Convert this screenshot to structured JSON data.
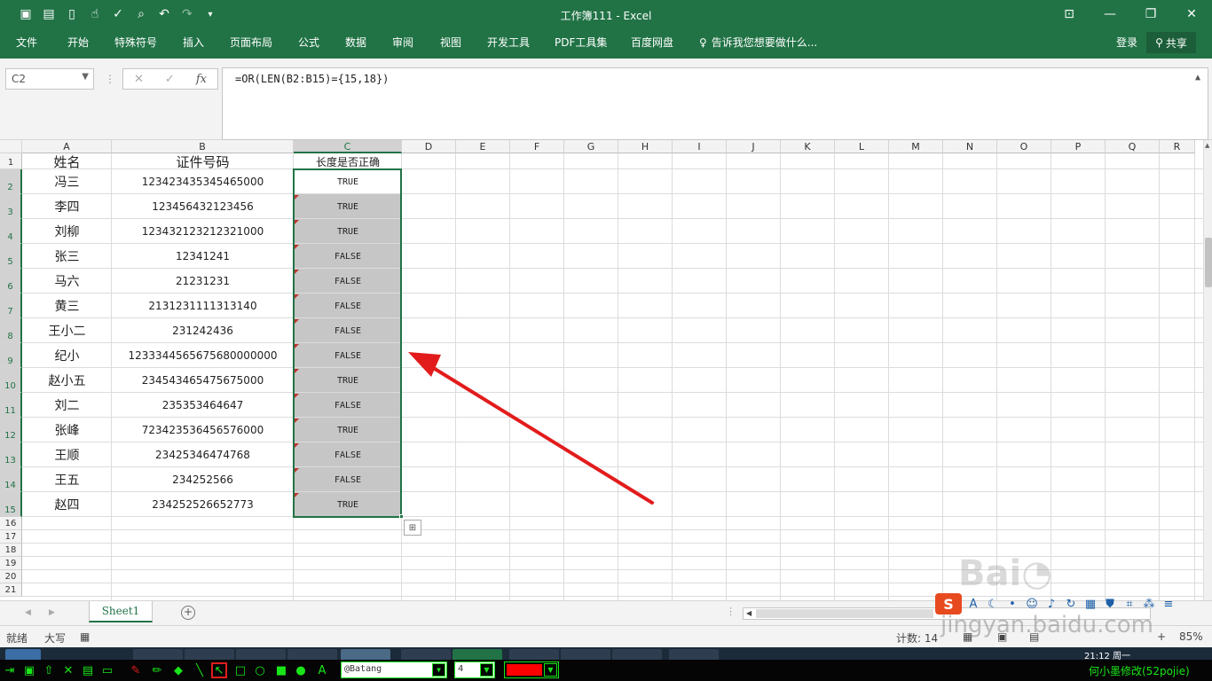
{
  "window": {
    "title": "工作簿111 - Excel"
  },
  "ribbon": {
    "tabs": [
      "文件",
      "开始",
      "特殊符号",
      "插入",
      "页面布局",
      "公式",
      "数据",
      "审阅",
      "视图",
      "开发工具",
      "PDF工具集",
      "百度网盘"
    ],
    "tell_me": "告诉我您想要做什么...",
    "login": "登录",
    "share": "共享"
  },
  "formula_bar": {
    "name_box": "C2",
    "formula": "=OR(LEN(B2:B15)={15,18})",
    "fx_label": "fx"
  },
  "grid": {
    "columns": [
      "A",
      "B",
      "C",
      "D",
      "E",
      "F",
      "G",
      "H",
      "I",
      "J",
      "K",
      "L",
      "M",
      "N",
      "O",
      "P",
      "Q",
      "R"
    ],
    "selected_column": "C",
    "row_numbers": [
      "1",
      "2",
      "3",
      "4",
      "5",
      "6",
      "7",
      "8",
      "9",
      "10",
      "11",
      "12",
      "13",
      "14",
      "15",
      "16",
      "17",
      "18",
      "19",
      "20",
      "21"
    ],
    "header_row": {
      "a": "姓名",
      "b": "证件号码",
      "c": "长度是否正确"
    },
    "rows": [
      {
        "name": "冯三",
        "id": "123423435345465000",
        "result": "TRUE"
      },
      {
        "name": "李四",
        "id": "123456432123456",
        "result": "TRUE"
      },
      {
        "name": "刘柳",
        "id": "123432123212321000",
        "result": "TRUE"
      },
      {
        "name": "张三",
        "id": "12341241",
        "result": "FALSE"
      },
      {
        "name": "马六",
        "id": "21231231",
        "result": "FALSE"
      },
      {
        "name": "黄三",
        "id": "2131231111313140",
        "result": "FALSE"
      },
      {
        "name": "王小二",
        "id": "231242436",
        "result": "FALSE"
      },
      {
        "name": "纪小",
        "id": "1233344565675680000000",
        "result": "FALSE"
      },
      {
        "name": "赵小五",
        "id": "234543465475675000",
        "result": "TRUE"
      },
      {
        "name": "刘二",
        "id": "235353464647",
        "result": "FALSE"
      },
      {
        "name": "张峰",
        "id": "723423536456576000",
        "result": "TRUE"
      },
      {
        "name": "王顺",
        "id": "23425346474768",
        "result": "FALSE"
      },
      {
        "name": "王五",
        "id": "234252566",
        "result": "FALSE"
      },
      {
        "name": "赵四",
        "id": "234252526652773",
        "result": "TRUE"
      }
    ]
  },
  "sheets": {
    "tabs": [
      "Sheet1"
    ]
  },
  "status_bar": {
    "ready": "就绪",
    "mode": "大写",
    "count": "计数: 14",
    "zoom": "85%"
  },
  "overlay": {
    "watermark": "jingyan.baidu.com",
    "clock": "21:12 周一",
    "draw_font": "@Batang",
    "draw_size": "4",
    "draw_color": "#ff0000",
    "credit": "何小墨修改(52pojie)"
  },
  "colors": {
    "excel_green": "#217346",
    "selection_fill": "#c6c6c6",
    "arrow_red": "#e21c1c"
  }
}
